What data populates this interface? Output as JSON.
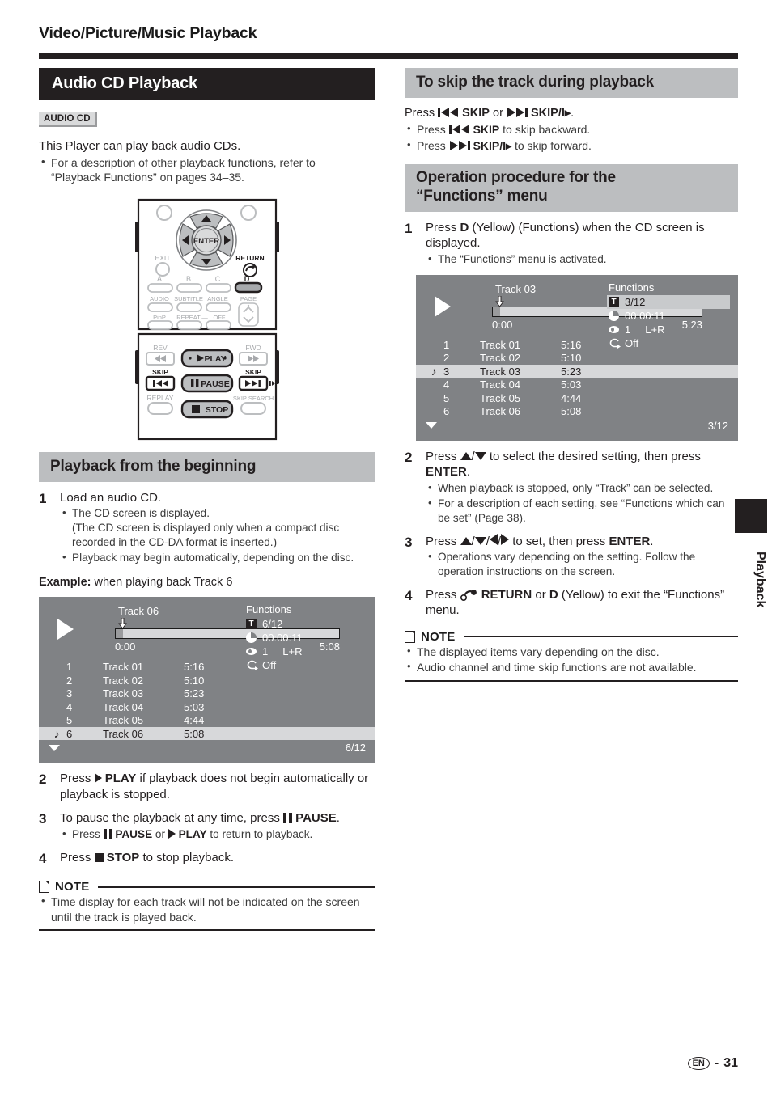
{
  "header": {
    "title": "Video/Picture/Music Playback"
  },
  "left": {
    "section_title": "Audio CD Playback",
    "badge": "AUDIO CD",
    "intro": "This Player can play back audio CDs.",
    "intro_bullets": [
      "For a description of other playback functions, refer to",
      "“Playback Functions” on pages 34–35."
    ],
    "remote": {
      "enter": "ENTER",
      "exit": "EXIT",
      "return": "RETURN",
      "color_a": "A",
      "color_b": "B",
      "color_c": "C",
      "color_d": "D",
      "audio": "AUDIO",
      "subtitle": "SUBTITLE",
      "angle": "ANGLE",
      "page": "PAGE",
      "pinp": "PinP",
      "repeat": "REPEAT",
      "dash": "—",
      "off": "OFF",
      "rev": "REV",
      "fwd": "FWD",
      "skip_left": "SKIP",
      "skip_right": "SKIP",
      "replay": "REPLAY",
      "skip_search": "SKIP SEARCH",
      "play": "PLAY",
      "pause": "PAUSE",
      "stop": "STOP"
    },
    "beginning_title": "Playback from the beginning",
    "steps": [
      {
        "num": "1",
        "lead": "Load an audio CD.",
        "bullets": [
          "The CD screen is displayed.",
          "(The CD screen is displayed only when a compact disc recorded in the CD-DA format is inserted.)",
          "Playback may begin automatically, depending on the disc."
        ]
      }
    ],
    "example_label": "Example:",
    "example_text": "when playing back Track 6",
    "step2_pre": "Press",
    "step2_bold": "PLAY",
    "step2_post": "if playback does not begin automatically or playback is stopped.",
    "step2_num": "2",
    "step3_num": "3",
    "step3_pre": "To pause the playback at any time, press",
    "step3_bold": "PAUSE",
    "step3_post": ".",
    "step3_bullet_pre": "Press",
    "step3_bullet_b1": "PAUSE",
    "step3_bullet_mid": "or",
    "step3_bullet_b2": "PLAY",
    "step3_bullet_post": "to return to playback.",
    "step4_num": "4",
    "step4_pre": "Press",
    "step4_bold": "STOP",
    "step4_post": "to stop playback.",
    "note_label": "NOTE",
    "note_items": [
      "Time display for each track will not be indicated on the screen until the track is played back."
    ]
  },
  "right": {
    "skip_title": "To skip the track during playback",
    "skip_press_pre": "Press",
    "skip_b1": "SKIP",
    "skip_or": "or",
    "skip_b2": "SKIP/I▸",
    "skip_end": ".",
    "skip_bullet1_pre": "Press",
    "skip_bullet1_bold": "SKIP",
    "skip_bullet1_post": "to skip backward.",
    "skip_bullet2_pre": "Press",
    "skip_bullet2_bold": "SKIP/I▸",
    "skip_bullet2_post": "to skip forward.",
    "functions_title_line1": "Operation procedure for the",
    "functions_title_line2": "“Functions” menu",
    "step1_num": "1",
    "step1_pre": "Press",
    "step1_b": "D",
    "step1_post": "(Yellow) (Functions) when the CD screen is displayed.",
    "step1_bullet": "The “Functions” menu is activated.",
    "step2_num": "2",
    "step2_pre": "Press",
    "step2_mid": "to select the desired setting, then press",
    "step2_b": "ENTER",
    "step2_end": ".",
    "step2_bullets": [
      "When playback is stopped, only “Track” can be selected.",
      "For a description of each setting, see “Functions which can be set” (Page 38)."
    ],
    "step3_num": "3",
    "step3_pre": "Press",
    "step3_mid": "to set, then press",
    "step3_b": "ENTER",
    "step3_end": ".",
    "step3_bullets": [
      "Operations vary depending on the setting. Follow the operation instructions on the screen."
    ],
    "step4_num": "4",
    "step4_pre": "Press",
    "step4_b1": "RETURN",
    "step4_mid": "or",
    "step4_b2": "D",
    "step4_post": "(Yellow) to exit the “Functions” menu.",
    "note_label": "NOTE",
    "note_items": [
      "The displayed items vary depending on the disc.",
      "Audio channel and time skip functions are not available."
    ]
  },
  "cd_screen_left": {
    "track_label": "Track 06",
    "time_start": "0:00",
    "time_end": "5:08",
    "functions_title": "Functions",
    "fn_track": "6/12",
    "fn_time": "00:00:11",
    "fn_audio": "1     L+R",
    "fn_repeat": "Off",
    "tracks": [
      {
        "note": "",
        "idx": "1",
        "name": "Track 01",
        "dur": "5:16",
        "selected": false
      },
      {
        "note": "",
        "idx": "2",
        "name": "Track 02",
        "dur": "5:10",
        "selected": false
      },
      {
        "note": "",
        "idx": "3",
        "name": "Track 03",
        "dur": "5:23",
        "selected": false
      },
      {
        "note": "",
        "idx": "4",
        "name": "Track 04",
        "dur": "5:03",
        "selected": false
      },
      {
        "note": "",
        "idx": "5",
        "name": "Track 05",
        "dur": "4:44",
        "selected": false
      },
      {
        "note": "♪",
        "idx": "6",
        "name": "Track 06",
        "dur": "5:08",
        "selected": true
      }
    ],
    "page_counter": "6/12",
    "highlight_fn": false
  },
  "cd_screen_right": {
    "track_label": "Track 03",
    "time_start": "0:00",
    "time_end": "5:23",
    "functions_title": "Functions",
    "fn_track": "3/12",
    "fn_time": "00:00:11",
    "fn_audio": "1     L+R",
    "fn_repeat": "Off",
    "tracks": [
      {
        "note": "",
        "idx": "1",
        "name": "Track 01",
        "dur": "5:16",
        "selected": false
      },
      {
        "note": "",
        "idx": "2",
        "name": "Track 02",
        "dur": "5:10",
        "selected": false
      },
      {
        "note": "♪",
        "idx": "3",
        "name": "Track 03",
        "dur": "5:23",
        "selected": true
      },
      {
        "note": "",
        "idx": "4",
        "name": "Track 04",
        "dur": "5:03",
        "selected": false
      },
      {
        "note": "",
        "idx": "5",
        "name": "Track 05",
        "dur": "4:44",
        "selected": false
      },
      {
        "note": "",
        "idx": "6",
        "name": "Track 06",
        "dur": "5:08",
        "selected": false
      }
    ],
    "page_counter": "3/12",
    "highlight_fn": true
  },
  "side_tab": {
    "label": "Playback"
  },
  "footer": {
    "lang": "EN",
    "sep": "-",
    "page": "31"
  },
  "colors": {
    "black_bar": "#231f20",
    "gray_bar": "#bcbec0",
    "screen_bg": "#808285",
    "screen_highlight": "#d7d8da",
    "badge_bg": "#d9dadb"
  }
}
